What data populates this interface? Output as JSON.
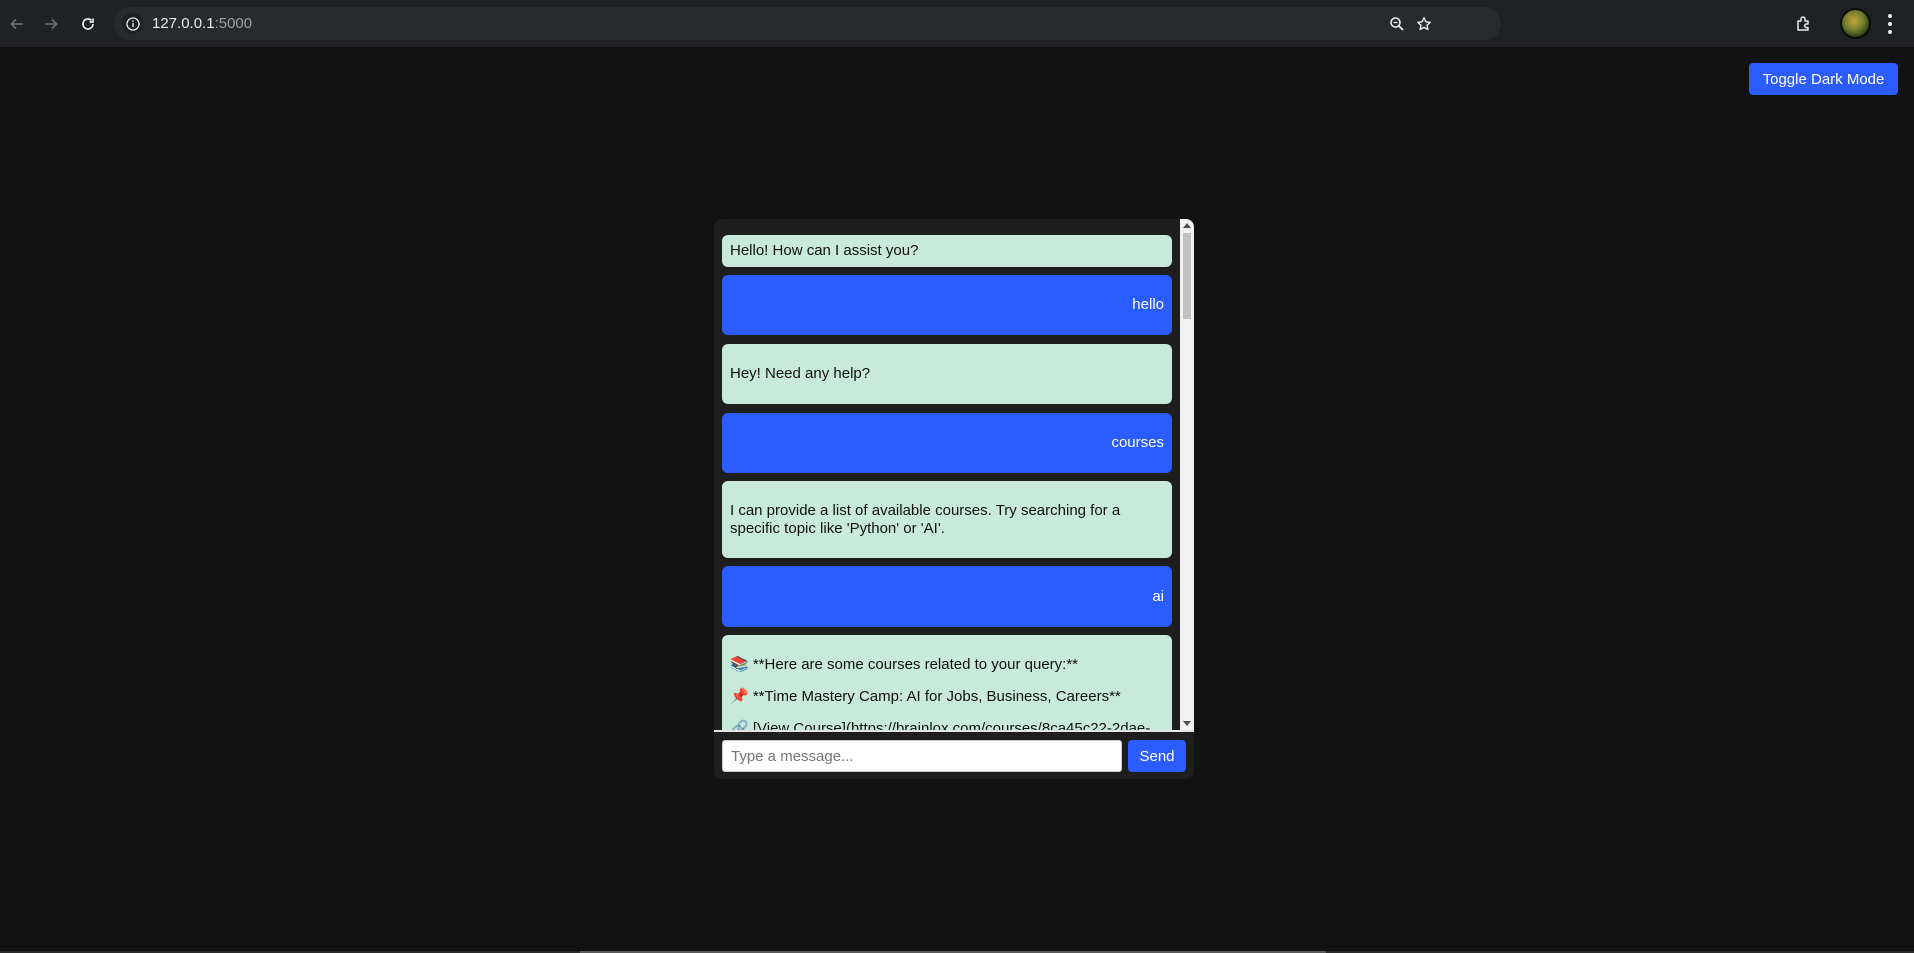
{
  "browser": {
    "url_host": "127.0.0.1",
    "url_port": ":5000"
  },
  "page": {
    "toggle_label": "Toggle Dark Mode",
    "accent_color": "#2b5cff",
    "bot_bubble_color": "#c8eadb"
  },
  "chat": {
    "messages": [
      {
        "role": "bot",
        "text": "Hello! How can I assist you?"
      },
      {
        "role": "user",
        "text": "hello"
      },
      {
        "role": "bot",
        "text": "Hey! Need any help?"
      },
      {
        "role": "user",
        "text": "courses"
      },
      {
        "role": "bot",
        "text": "I can provide a list of available courses. Try searching for a specific topic like 'Python' or 'AI'."
      },
      {
        "role": "user",
        "text": "ai"
      },
      {
        "role": "bot",
        "lines": [
          "📚 **Here are some courses related to your query:**",
          "📌 **Time Mastery Camp: AI for Jobs, Business, Careers**",
          "🔗 [View Course](https://brainlox.com/courses/8ca45c22-2dae-"
        ]
      }
    ],
    "input_placeholder": "Type a message...",
    "send_label": "Send"
  }
}
